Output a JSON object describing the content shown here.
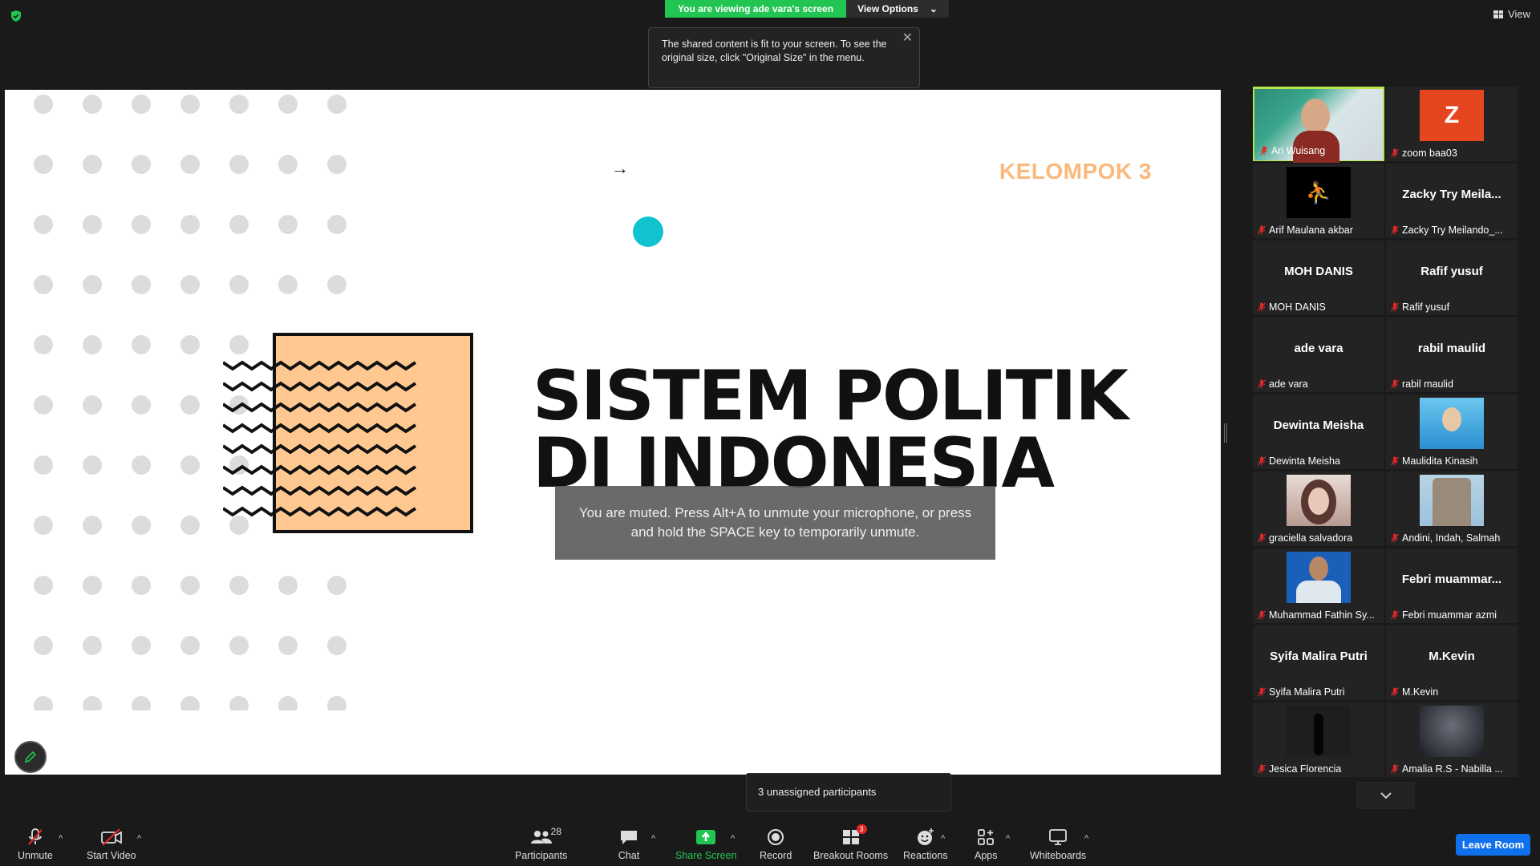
{
  "topbar": {
    "viewing_label": "You are viewing ade vara's screen",
    "view_options_label": "View Options",
    "view_label": "View"
  },
  "tooltip": {
    "text": "The shared content is fit to your screen. To see the original size, click \"Original Size\" in the menu."
  },
  "slide": {
    "group_label": "KELOMPOK 3",
    "title_line1": "SISTEM POLITIK",
    "title_line2": "DI INDONESIA",
    "accent_orange": "#ffc891",
    "accent_teal": "#10c3cf"
  },
  "muted_notice": "You are muted. Press Alt+A to unmute your microphone, or press and hold the SPACE key to temporarily unmute.",
  "participants": [
    {
      "name": "Ari Wuisang",
      "big": "",
      "type": "video-person",
      "active": true
    },
    {
      "name": "zoom baa03",
      "big": "Z",
      "type": "avatar-z"
    },
    {
      "name": "Arif Maulana akbar",
      "big": "",
      "type": "jordan-logo"
    },
    {
      "name": "Zacky Try Meilando_...",
      "big": "Zacky  Try  Meila...",
      "type": "text"
    },
    {
      "name": "MOH DANIS",
      "big": "MOH DANIS",
      "type": "text"
    },
    {
      "name": "Rafif yusuf",
      "big": "Rafif yusuf",
      "type": "text"
    },
    {
      "name": "ade vara",
      "big": "ade vara",
      "type": "text"
    },
    {
      "name": "rabil maulid",
      "big": "rabil maulid",
      "type": "text"
    },
    {
      "name": "Dewinta Meisha",
      "big": "Dewinta Meisha",
      "type": "text"
    },
    {
      "name": "Maulidita Kinasih",
      "big": "",
      "type": "photo-blue"
    },
    {
      "name": "graciella salvadora",
      "big": "",
      "type": "photo-girl"
    },
    {
      "name": "Andini, Indah, Salmah",
      "big": "",
      "type": "photo-statue"
    },
    {
      "name": "Muhammad Fathin Sy...",
      "big": "",
      "type": "photo-man"
    },
    {
      "name": "Febri muammar azmi",
      "big": "Febri  muammar...",
      "type": "text"
    },
    {
      "name": "Syifa Malira Putri",
      "big": "Syifa Malira Putri",
      "type": "text"
    },
    {
      "name": "M.Kevin",
      "big": "M.Kevin",
      "type": "text"
    },
    {
      "name": "Jesica Florencia",
      "big": "",
      "type": "photo-dark-person"
    },
    {
      "name": "Amalia R.S - Nabilla ...",
      "big": "",
      "type": "photo-night"
    }
  ],
  "unassigned": "3 unassigned participants",
  "toolbar": {
    "unmute": "Unmute",
    "start_video": "Start Video",
    "participants": "Participants",
    "participants_count": "28",
    "chat": "Chat",
    "share_screen": "Share Screen",
    "record": "Record",
    "breakout_rooms": "Breakout Rooms",
    "breakout_badge": "3",
    "reactions": "Reactions",
    "apps": "Apps",
    "whiteboards": "Whiteboards",
    "leave_room": "Leave Room"
  }
}
